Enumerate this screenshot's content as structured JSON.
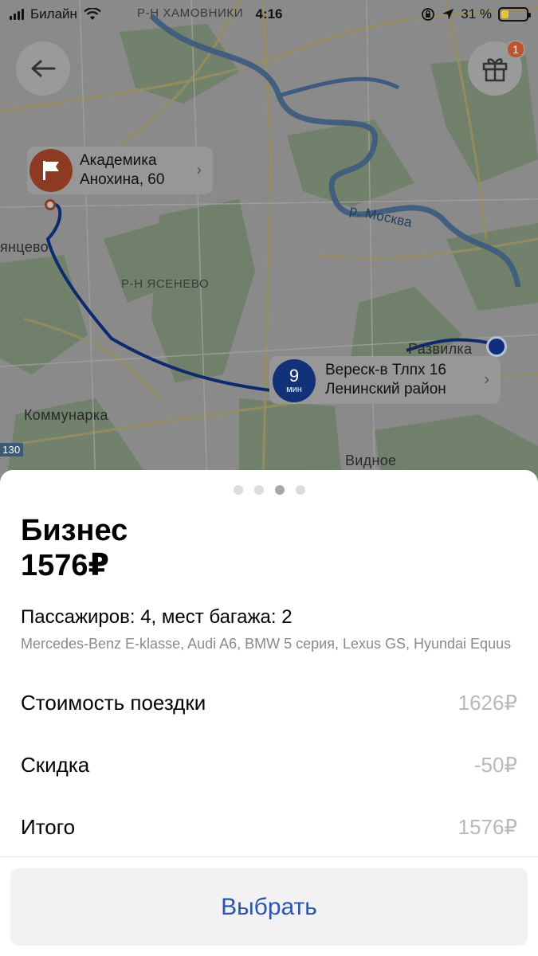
{
  "status_bar": {
    "carrier": "Билайн",
    "time": "4:16",
    "battery_percent": "31 %",
    "battery_level": 0.31
  },
  "map": {
    "labels": {
      "district_top": "Р-Н ХАМОВНИКИ",
      "district_yasenevo": "Р-Н ЯСЕНЕВО",
      "river": "р. Москва",
      "town_left": "янцево",
      "town_kommunarka": "Коммунарка",
      "town_vidnoe": "Видное",
      "town_razvilka": "Развилка",
      "road_number": "130"
    },
    "destination_pin": {
      "line1": "Академика",
      "line2": "Анохина, 60"
    },
    "origin_pin": {
      "eta_value": "9",
      "eta_unit": "мин",
      "line1": "Вереск-в Тлпх 16",
      "line2": "Ленинский район"
    },
    "gift_badge": "1",
    "icons": {
      "back": "arrow-left-icon",
      "gift": "gift-icon",
      "flag": "flag-icon"
    }
  },
  "sheet": {
    "page_dots": 4,
    "active_dot": 2,
    "tariff_name": "Бизнес",
    "tariff_price": "1576₽",
    "capacity": "Пассажиров: 4, мест багажа: 2",
    "models": "Mercedes-Benz E-klasse, Audi A6, BMW 5 серия, Lexus GS, Hyundai Equus",
    "rows": [
      {
        "label": "Стоимость поездки",
        "value": "1626₽"
      },
      {
        "label": "Скидка",
        "value": "-50₽"
      },
      {
        "label": "Итого",
        "value": "1576₽"
      }
    ],
    "select_label": "Выбрать"
  }
}
